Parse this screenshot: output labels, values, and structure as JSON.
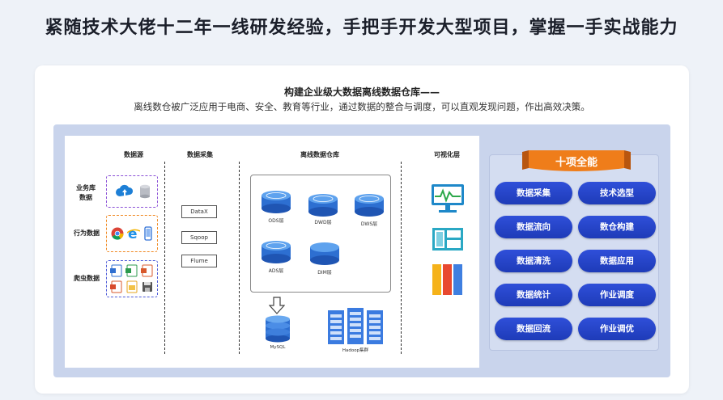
{
  "headline": "紧随技术大佬十二年一线研发经验，手把手开发大型项目，掌握一手实战能力",
  "card": {
    "title": "构建企业级大数据离线数据仓库——",
    "subtitle": "离线数仓被广泛应用于电商、安全、教育等行业，通过数据的整合与调度，可以直观发现问题，作出高效决策。"
  },
  "arch": {
    "columns": {
      "sources": "数据源",
      "collect": "数据采集",
      "warehouse": "离线数据仓库",
      "viz": "可视化层"
    },
    "sources": [
      {
        "label": "业务库\n数据",
        "color": "#8a4fd6"
      },
      {
        "label": "行为数据",
        "color": "#f08a24"
      },
      {
        "label": "爬虫数据",
        "color": "#4d5bd8"
      }
    ],
    "tools": [
      "DataX",
      "Sqoop",
      "Flume"
    ],
    "layers": {
      "ods": "ODS层",
      "dwd": "DWD层",
      "dws": "DWS层",
      "ads": "ADS层",
      "dim": "DIM层"
    },
    "mysql": "MySQL",
    "hadoop": "Hadoop集群"
  },
  "skills": {
    "title": "十项全能",
    "items": [
      "数据采集",
      "技术选型",
      "数据流向",
      "数仓构建",
      "数据清洗",
      "数据应用",
      "数据统计",
      "作业调度",
      "数据回流",
      "作业调优"
    ]
  },
  "colors": {
    "accent_blue": "#2344c9",
    "ribbon_orange": "#ef7d1a",
    "panel": "#c9d4ec"
  }
}
